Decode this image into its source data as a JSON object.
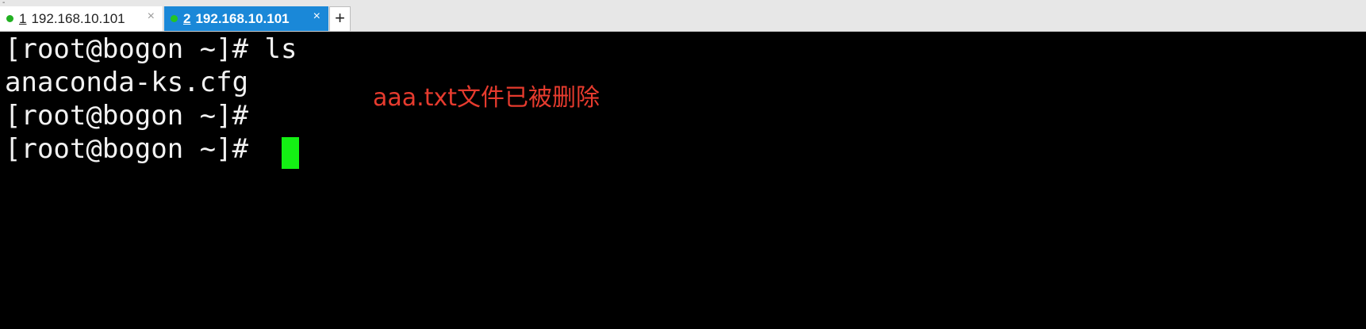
{
  "tabs": [
    {
      "number": "1",
      "host": "192.168.10.101",
      "active": false,
      "close": "×"
    },
    {
      "number": "2",
      "host": "192.168.10.101",
      "active": true,
      "close": "×"
    }
  ],
  "new_tab_label": "+",
  "corner_mark": "-",
  "terminal": {
    "lines": [
      "[root@bogon ~]# ls",
      "anaconda-ks.cfg",
      "[root@bogon ~]#",
      "[root@bogon ~]# "
    ],
    "cursor_color": "#14f014"
  },
  "annotation": "aaa.txt文件已被删除",
  "colors": {
    "active_tab": "#1a88d8",
    "status_dot": "#22b022",
    "annotation": "#e63b2e"
  }
}
